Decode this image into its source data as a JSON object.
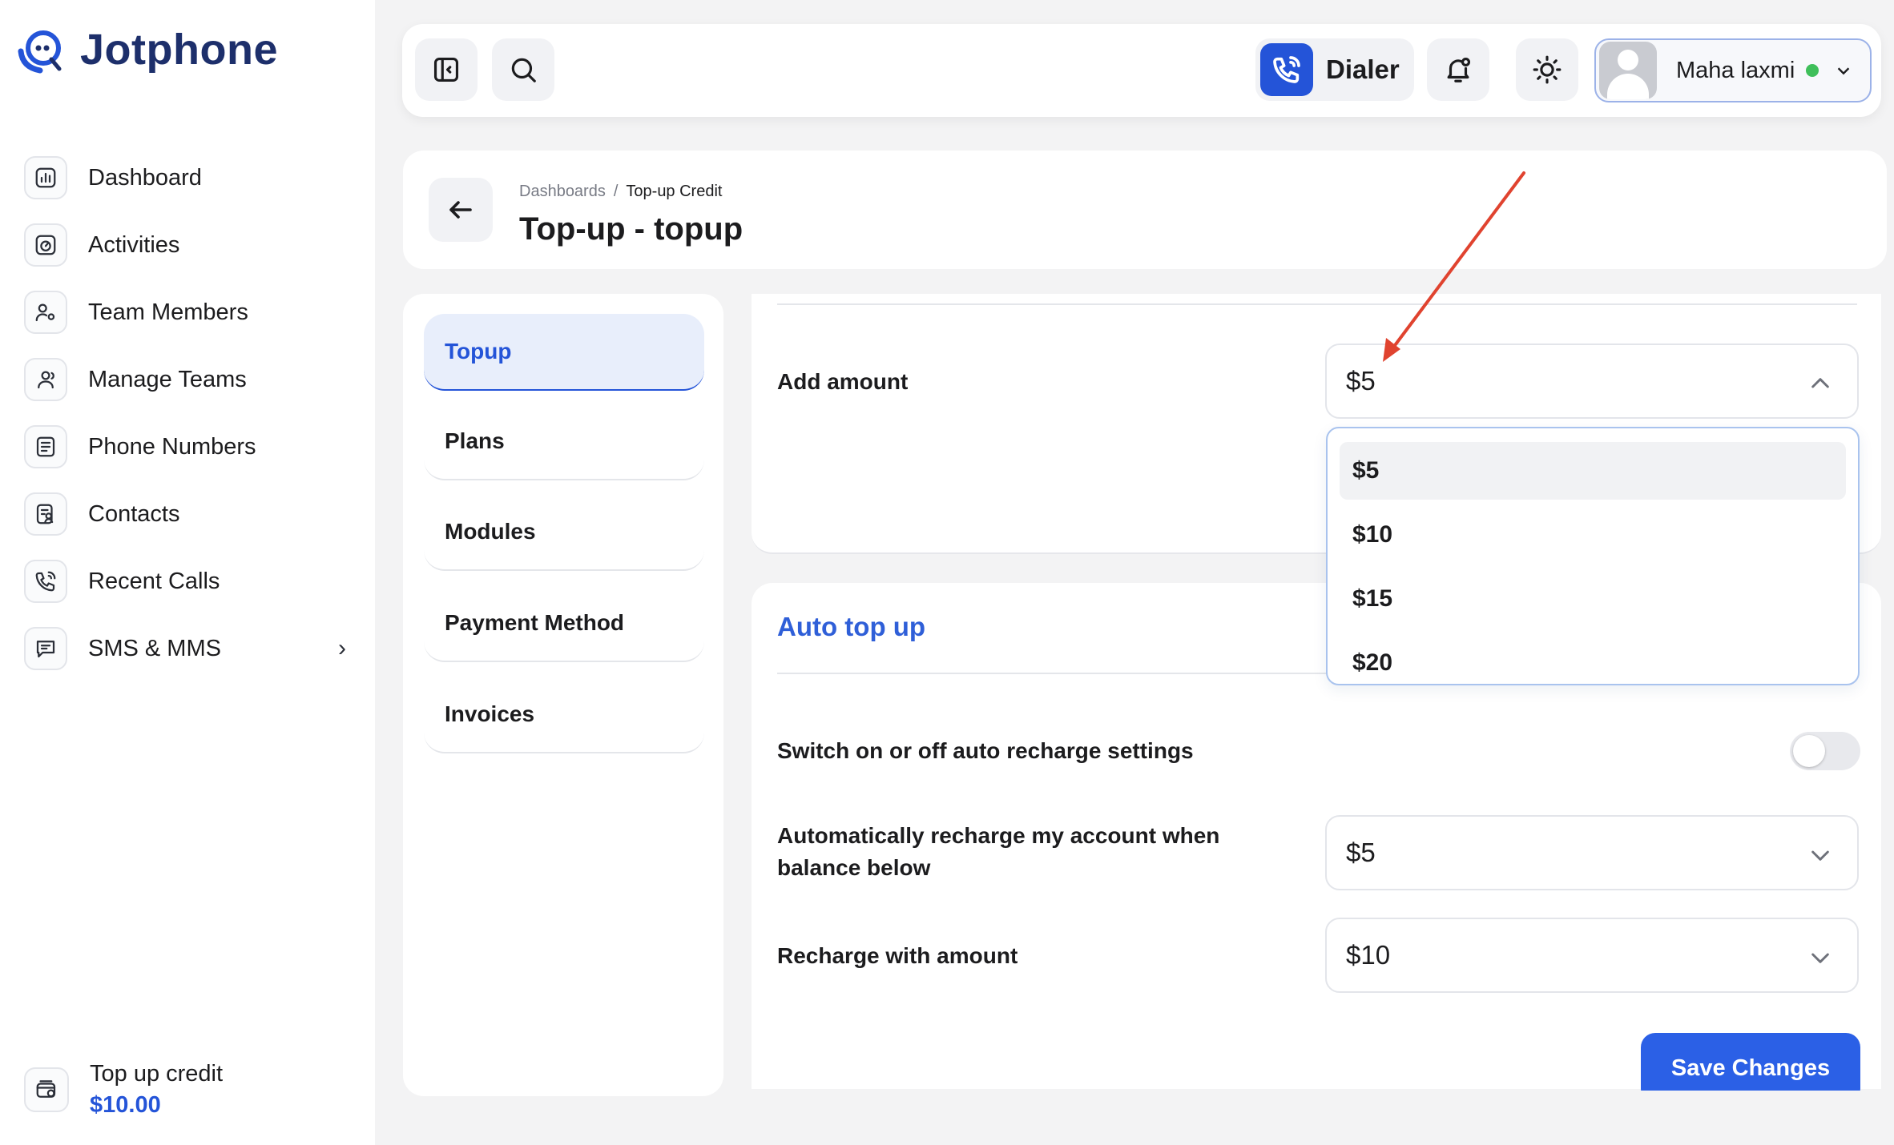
{
  "brand": {
    "name": "Jotphone"
  },
  "sidebar": {
    "items": [
      {
        "label": "Dashboard",
        "icon": "chart-icon"
      },
      {
        "label": "Activities",
        "icon": "gauge-icon"
      },
      {
        "label": "Team Members",
        "icon": "user-gear-icon"
      },
      {
        "label": "Manage Teams",
        "icon": "users-icon"
      },
      {
        "label": "Phone Numbers",
        "icon": "phone-list-icon"
      },
      {
        "label": "Contacts",
        "icon": "contacts-icon"
      },
      {
        "label": "Recent Calls",
        "icon": "phone-call-icon"
      },
      {
        "label": "SMS & MMS",
        "icon": "message-icon"
      }
    ],
    "credit": {
      "label": "Top up credit",
      "value": "$10.00"
    }
  },
  "topbar": {
    "dialer_label": "Dialer",
    "user_name": "Maha laxmi",
    "status_color": "#3fbf5a"
  },
  "header": {
    "breadcrumb": [
      "Dashboards",
      "/",
      "Top-up Credit"
    ],
    "title": "Top-up - topup"
  },
  "tabs": [
    "Topup",
    "Plans",
    "Modules",
    "Payment Method",
    "Invoices"
  ],
  "topup": {
    "add_amount_label": "Add amount",
    "add_amount_value": "$5",
    "options": [
      "$5",
      "$10",
      "$15",
      "$20"
    ]
  },
  "auto_topup": {
    "title": "Auto top up",
    "switch_label": "Switch on or off auto recharge settings",
    "switch_on": false,
    "threshold_label": "Automatically recharge my account when balance below",
    "threshold_value": "$5",
    "recharge_label": "Recharge with amount",
    "recharge_value": "$10",
    "save_label": "Save Changes"
  },
  "colors": {
    "accent": "#2454d8",
    "brand": "#1d2f6b",
    "annotation": "#e0432f"
  }
}
